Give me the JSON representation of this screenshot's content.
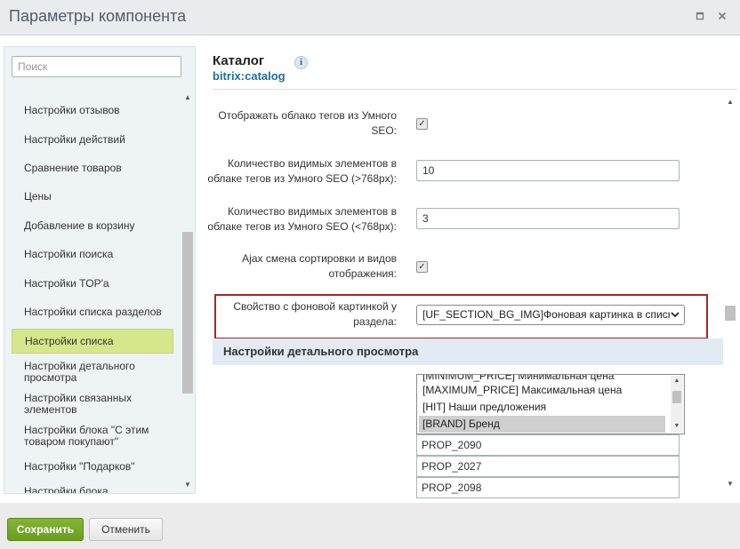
{
  "window": {
    "title": "Параметры компонента",
    "maximize_icon": "maximize-icon",
    "close_icon": "close-icon"
  },
  "sidebar": {
    "search_placeholder": "Поиск",
    "items": [
      {
        "label": "Настройки отзывов",
        "active": false
      },
      {
        "label": "Настройки действий",
        "active": false
      },
      {
        "label": "Сравнение товаров",
        "active": false
      },
      {
        "label": "Цены",
        "active": false
      },
      {
        "label": "Добавление в корзину",
        "active": false
      },
      {
        "label": "Настройки поиска",
        "active": false
      },
      {
        "label": "Настройки TOP'а",
        "active": false
      },
      {
        "label": "Настройки списка разделов",
        "active": false
      },
      {
        "label": "Настройки списка",
        "active": true
      },
      {
        "label": "Настройки детального просмотра",
        "active": false
      },
      {
        "label": "Настройки связанных элементов",
        "active": false
      },
      {
        "label": "Настройки блока \"С этим товаром покупают\"",
        "active": false
      },
      {
        "label": "Настройки \"Подарков\"",
        "active": false
      },
      {
        "label": "Настройки блока",
        "active": false
      }
    ]
  },
  "component": {
    "title": "Каталог",
    "code": "bitrix:catalog",
    "info_icon": "info-icon"
  },
  "fields": [
    {
      "label_line1": "Отображать облако тегов из Умного",
      "label_line2": "SEO:",
      "type": "checkbox",
      "checked": true
    },
    {
      "label_line1": "Количество видимых элементов в",
      "label_line2": "облаке тегов из Умного SEO (>768px):",
      "type": "text",
      "value": "10"
    },
    {
      "label_line1": "Количество видимых элементов в",
      "label_line2": "облаке тегов из Умного SEO (<768px):",
      "type": "text",
      "value": "3"
    },
    {
      "label_line1": "Ajax смена сортировки и видов",
      "label_line2": "отображения:",
      "type": "checkbox",
      "checked": true
    },
    {
      "label_line1": "Свойство с фоновой картинкой у",
      "label_line2": "раздела:",
      "type": "select",
      "value": "[UF_SECTION_BG_IMG]Фоновая картинка в списке"
    }
  ],
  "section": {
    "title": "Настройки детального просмотра"
  },
  "listbox": {
    "options": [
      {
        "label": "[MINIMUM_PRICE] Минимальная цена",
        "selected": false
      },
      {
        "label": "[MAXIMUM_PRICE] Максимальная цена",
        "selected": false
      },
      {
        "label": "[HIT] Наши предложения",
        "selected": false
      },
      {
        "label": "[BRAND] Бренд",
        "selected": true
      }
    ]
  },
  "props": [
    "PROP_2090",
    "PROP_2027",
    "PROP_2098"
  ],
  "footer": {
    "save_label": "Сохранить",
    "cancel_label": "Отменить"
  },
  "colors": {
    "save_button": "#74a82a",
    "active_nav": "#d6e68a",
    "highlight_border": "#a02a23",
    "section_header": "#e2ebf3",
    "link": "#1f6f9a"
  }
}
